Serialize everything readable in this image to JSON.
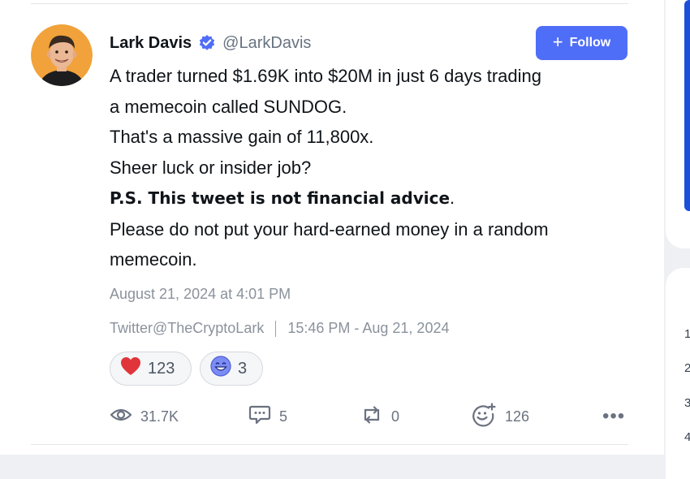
{
  "post": {
    "author_name": "Lark Davis",
    "author_handle": "@LarkDavis",
    "follow_label": "Follow",
    "follow_icon": "+",
    "lines": [
      "A trader turned $1.69K into $20M in just 6 days trading",
      "a memecoin called SUNDOG.",
      "That's a massive gain of 11,800x.",
      "Sheer luck or insider job?"
    ],
    "disclaimer_bold": "P.S. This tweet is not financial advice",
    "disclaimer_period": ".",
    "closing_lines": [
      "Please do not put your hard-earned money in a random",
      "memecoin."
    ],
    "date": "August 21, 2024 at 4:01 PM",
    "source": "Twitter@TheCryptoLark",
    "source_time": "15:46 PM - Aug 21, 2024",
    "reactions": [
      {
        "icon": "heart-icon",
        "count": "123"
      },
      {
        "icon": "grinning-face-icon",
        "count": "3"
      }
    ],
    "stats": {
      "views": "31.7K",
      "comments": "5",
      "retweets": "0",
      "likes": "126"
    },
    "more_label": "•••"
  },
  "sidebar": {
    "ranks": [
      "1",
      "2",
      "3",
      "4"
    ]
  },
  "colors": {
    "accent": "#4f6ef7",
    "verified": "#4f6ef7",
    "muted_text": "#8b929c",
    "heart": "#e0353b"
  }
}
